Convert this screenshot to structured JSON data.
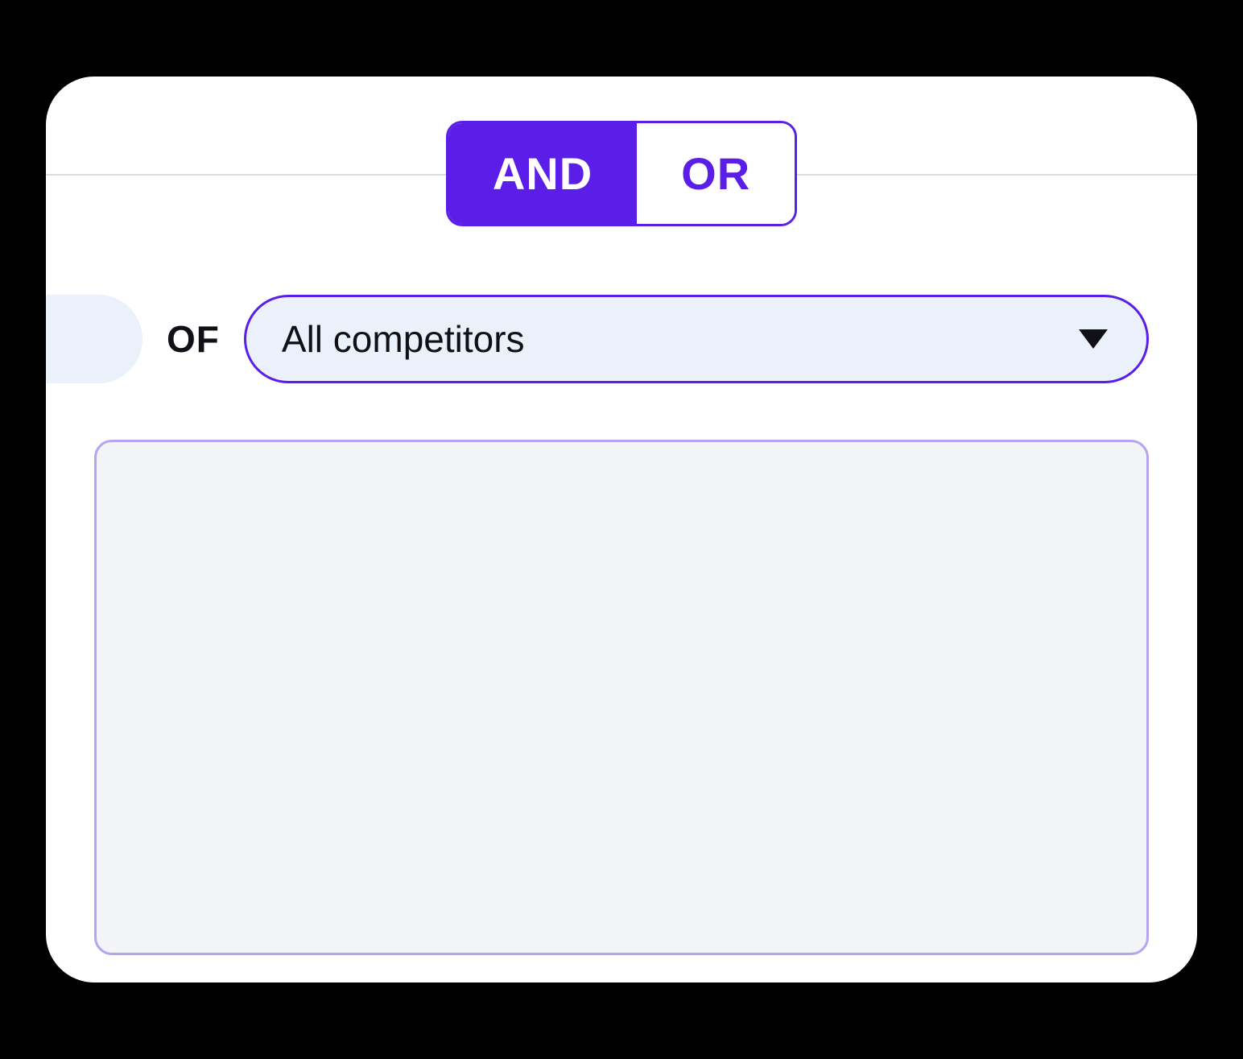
{
  "toggle": {
    "and_label": "AND",
    "or_label": "OR",
    "active": "and"
  },
  "filter": {
    "of_label": "OF",
    "dropdown_value": "All competitors"
  },
  "colors": {
    "accent": "#5b1de8",
    "accent_light": "#b7a4f1",
    "dropdown_bg": "#eaf1fb",
    "box_bg": "#f2f4f8"
  }
}
